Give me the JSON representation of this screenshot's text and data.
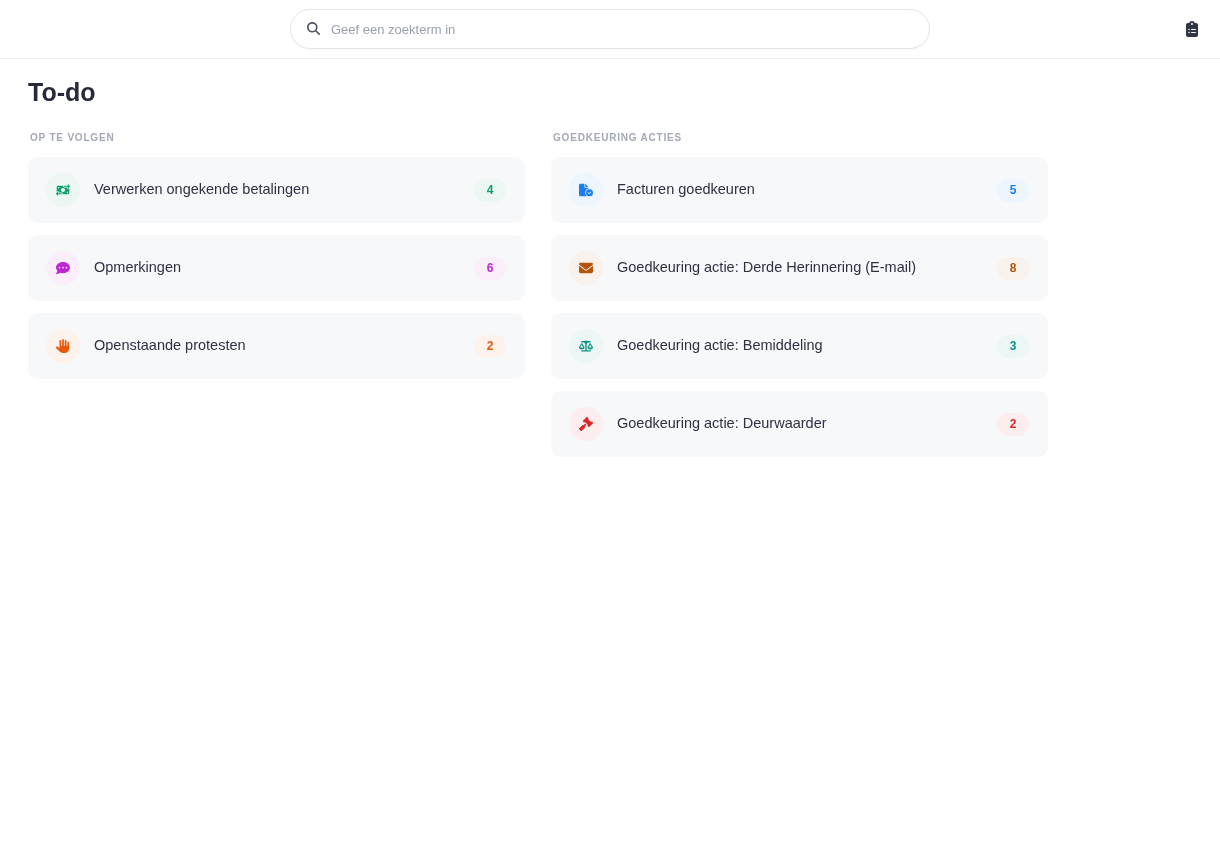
{
  "search": {
    "placeholder": "Geef een zoekterm in"
  },
  "page_title": "To-do",
  "sections": [
    {
      "title": "OP TE VOLGEN",
      "items": [
        {
          "label": "Verwerken ongekende betalingen",
          "count": "4",
          "color": "#0e9f6e"
        },
        {
          "label": "Opmerkingen",
          "count": "6",
          "color": "#c026d3"
        },
        {
          "label": "Openstaande protesten",
          "count": "2",
          "color": "#ea580c"
        }
      ]
    },
    {
      "title": "GOEDKEURING ACTIES",
      "items": [
        {
          "label": "Facturen goedkeuren",
          "count": "5",
          "color": "#1c7cf4"
        },
        {
          "label": "Goedkeuring actie: Derde Herinnering (E-mail)",
          "count": "8",
          "color": "#b45309"
        },
        {
          "label": "Goedkeuring actie: Bemiddeling",
          "count": "3",
          "color": "#0d9488"
        },
        {
          "label": "Goedkeuring actie: Deurwaarder",
          "count": "2",
          "color": "#dc2626"
        }
      ]
    }
  ]
}
